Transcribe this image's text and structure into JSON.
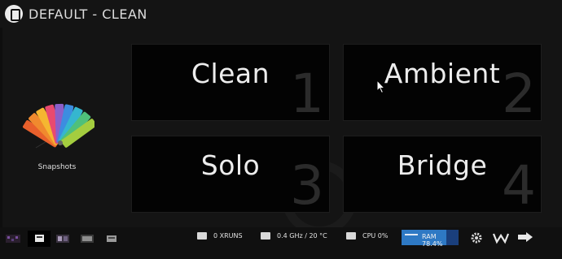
{
  "window": {
    "title": "DEFAULT - CLEAN"
  },
  "snapshots": {
    "label": "Snapshots",
    "icon": "color-swatch-fan-icon"
  },
  "pedalboards": [
    {
      "name": "Clean",
      "number": "1"
    },
    {
      "name": "Ambient",
      "number": "2"
    },
    {
      "name": "Solo",
      "number": "3"
    },
    {
      "name": "Bridge",
      "number": "4"
    }
  ],
  "footer": {
    "xruns": "0 XRUNS",
    "cpu_freq_temp": "0.4 GHz / 20 °C",
    "cpu": "CPU 0%",
    "ram": "RAM 78.4%",
    "ram_fraction": 0.784
  },
  "colors": {
    "background": "#141414",
    "pedal_background": "#030303",
    "ram_bar": "#2e79c4",
    "watermark_number": "#2b2b2b"
  }
}
